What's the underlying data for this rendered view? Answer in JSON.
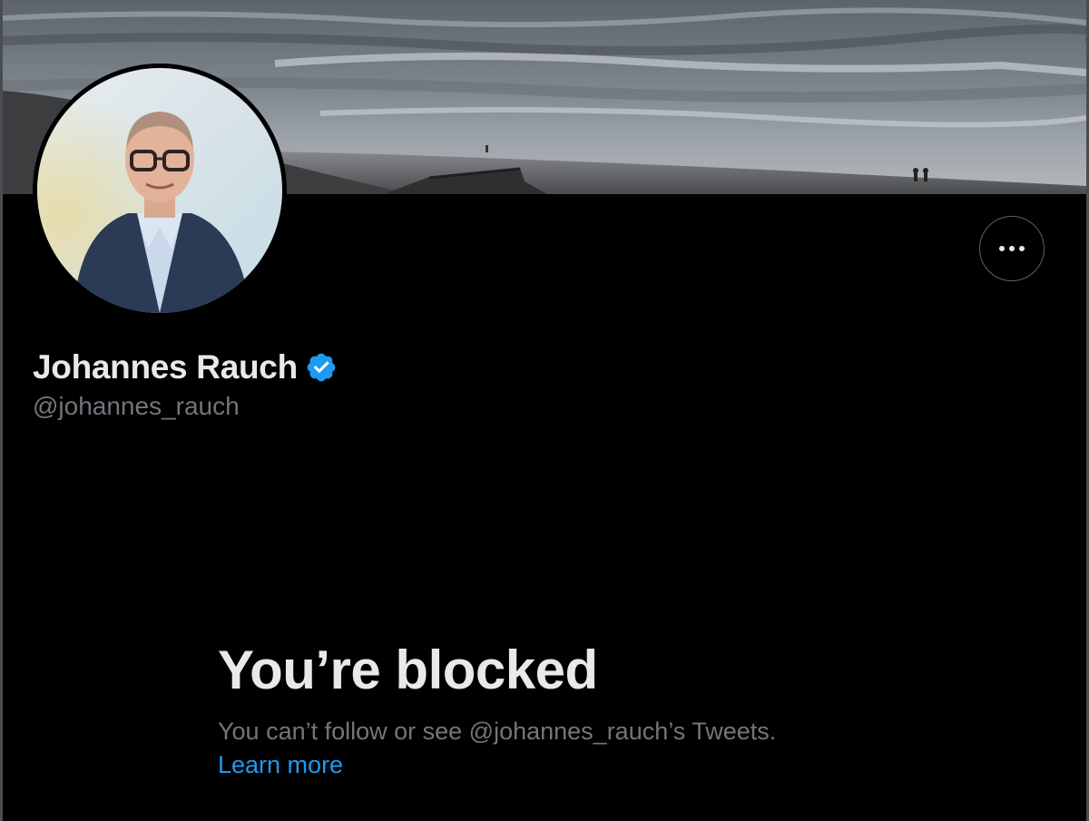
{
  "profile": {
    "display_name": "Johannes Rauch",
    "handle": "@johannes_rauch",
    "verified": true
  },
  "icons": {
    "verified": "verified-badge-icon",
    "more": "more-options-icon"
  },
  "blocked": {
    "title": "You’re blocked",
    "description": "You can’t follow or see @johannes_rauch’s Tweets.",
    "learn_more": "Learn more"
  },
  "colors": {
    "background": "#000000",
    "primary_text": "#e7e9ea",
    "secondary_text": "#71767b",
    "link": "#1d9bf0",
    "verified": "#1d9bf0",
    "button_border": "#536471"
  }
}
